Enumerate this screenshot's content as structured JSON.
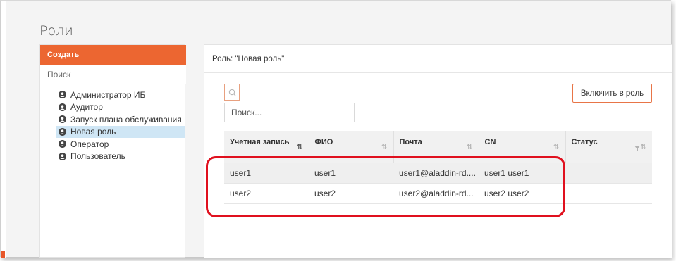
{
  "page_title": "Роли",
  "sidebar": {
    "create_label": "Создать",
    "search_label": "Поиск",
    "roles": [
      {
        "label": "Администратор ИБ",
        "selected": false
      },
      {
        "label": "Аудитор",
        "selected": false
      },
      {
        "label": "Запуск плана обслуживания",
        "selected": false
      },
      {
        "label": "Новая роль",
        "selected": true
      },
      {
        "label": "Оператор",
        "selected": false
      },
      {
        "label": "Пользователь",
        "selected": false
      }
    ]
  },
  "main": {
    "header": "Роль: \"Новая роль\"",
    "search_placeholder": "Поиск...",
    "include_button": "Включить в роль",
    "table": {
      "columns": [
        {
          "label": "Учетная запись",
          "sort": "active"
        },
        {
          "label": "ФИО",
          "sort": "none"
        },
        {
          "label": "Почта",
          "sort": "none"
        },
        {
          "label": "CN",
          "sort": "none"
        },
        {
          "label": "Статус",
          "sort": "filter"
        }
      ],
      "rows": [
        [
          "user1",
          "user1",
          "user1@aladdin-rd....",
          "user1 user1",
          ""
        ],
        [
          "user2",
          "user2",
          "user2@aladdin-rd...",
          "user2 user2",
          ""
        ]
      ]
    }
  },
  "colors": {
    "accent": "#ec6631",
    "selected_bg": "#cfe6f5",
    "highlight": "#e0101e"
  },
  "icons": {
    "role": "user-circle-icon",
    "search": "search-icon",
    "sort": "sort-arrows-icon",
    "filter": "filter-icon"
  }
}
